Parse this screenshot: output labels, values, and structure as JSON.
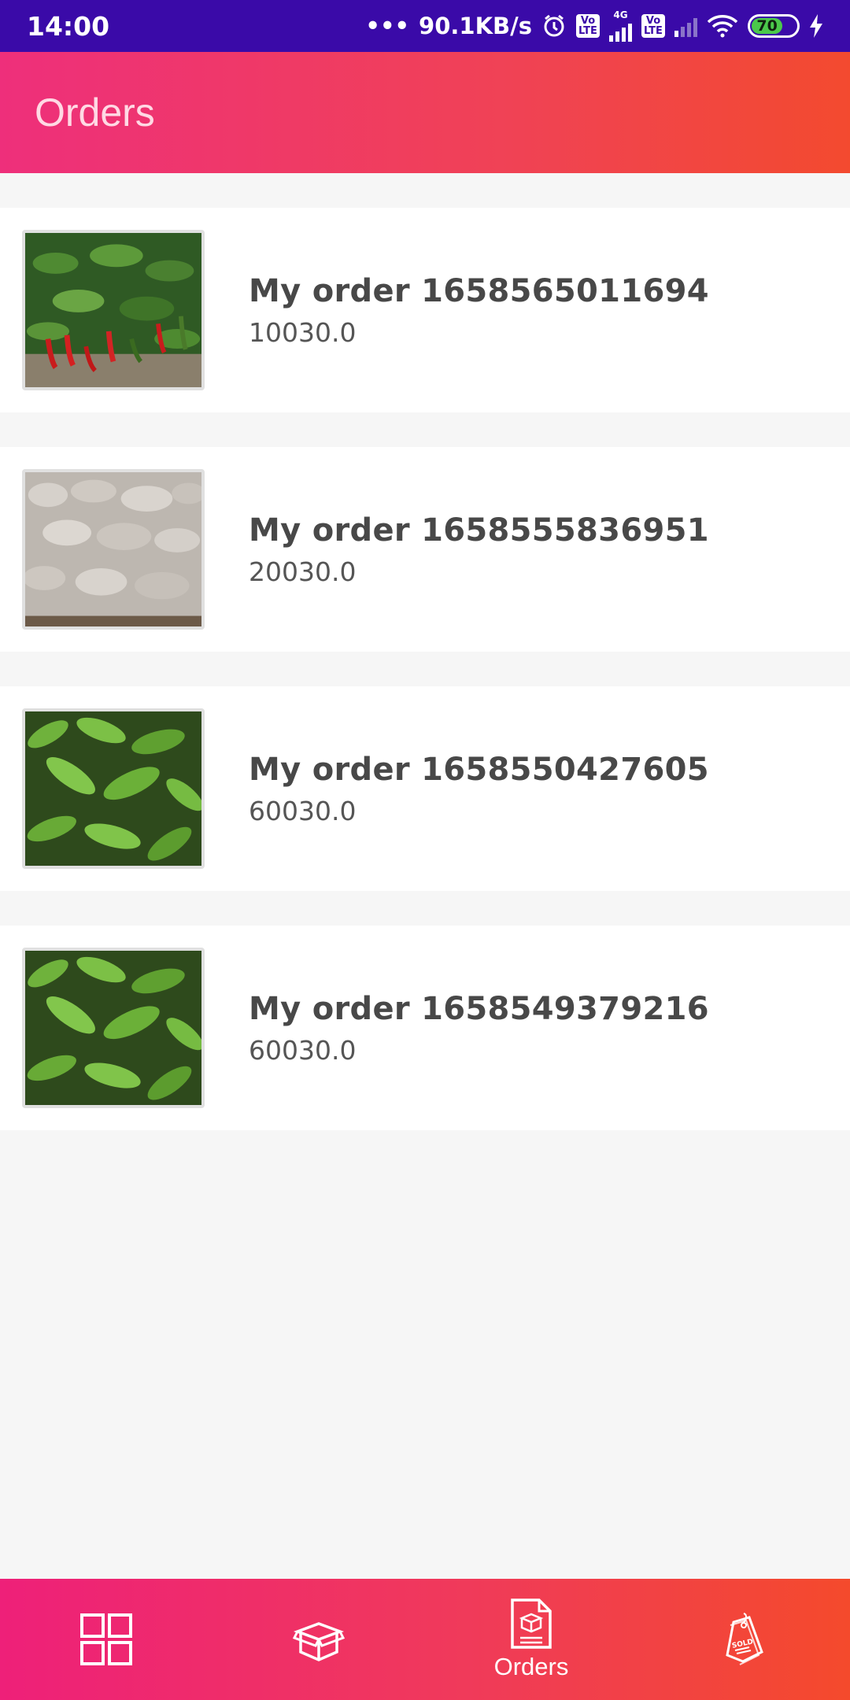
{
  "status_bar": {
    "time": "14:00",
    "network_speed": "90.1KB/s",
    "network_type": "4G",
    "volte_label": "Vo LTE",
    "battery": "70"
  },
  "app_bar": {
    "title": "Orders"
  },
  "orders": [
    {
      "title": "My order 1658565011694",
      "price": "10030.0",
      "image": "chili-plants"
    },
    {
      "title": "My order 1658555836951",
      "price": "20030.0",
      "image": "cotton"
    },
    {
      "title": "My order 1658550427605",
      "price": "60030.0",
      "image": "pepper-leaves"
    },
    {
      "title": "My order 1658549379216",
      "price": "60030.0",
      "image": "pepper-leaves"
    }
  ],
  "bottom_nav": {
    "items": [
      {
        "icon": "dashboard-grid-icon",
        "label": ""
      },
      {
        "icon": "box-icon",
        "label": ""
      },
      {
        "icon": "orders-document-icon",
        "label": "Orders",
        "active": true
      },
      {
        "icon": "sold-tag-icon",
        "label": ""
      }
    ]
  }
}
